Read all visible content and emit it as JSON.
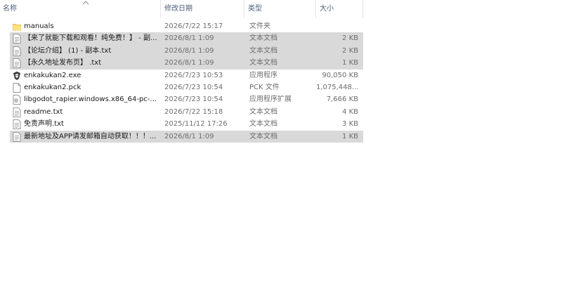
{
  "columns": {
    "name": "名称",
    "date": "修改日期",
    "type": "类型",
    "size": "大小"
  },
  "files": [
    {
      "name": "manuals",
      "date": "2026/7/22 15:17",
      "type": "文件夹",
      "size": "",
      "icon": "folder-icon",
      "selected": false
    },
    {
      "name": "【来了就能下载和观看！纯免费！】 - 副...",
      "date": "2026/8/1 1:09",
      "type": "文本文档",
      "size": "2 KB",
      "icon": "text-file-icon",
      "selected": true
    },
    {
      "name": "【论坛介绍】 (1) - 副本.txt",
      "date": "2026/8/1 1:09",
      "type": "文本文档",
      "size": "2 KB",
      "icon": "text-file-icon",
      "selected": true
    },
    {
      "name": "【永久地址发布页】 .txt",
      "date": "2026/8/1 1:09",
      "type": "文本文档",
      "size": "1 KB",
      "icon": "text-file-icon",
      "selected": true
    },
    {
      "name": "enkakukan2.exe",
      "date": "2026/7/23 10:53",
      "type": "应用程序",
      "size": "90,050 KB",
      "icon": "app-exe-icon",
      "selected": false
    },
    {
      "name": "enkakukan2.pck",
      "date": "2026/7/23 10:54",
      "type": "PCK 文件",
      "size": "1,075,448...",
      "icon": "blank-file-icon",
      "selected": false
    },
    {
      "name": "libgodot_rapier.windows.x86_64-pc-...",
      "date": "2026/7/23 10:54",
      "type": "应用程序扩展",
      "size": "7,666 KB",
      "icon": "dll-file-icon",
      "selected": false
    },
    {
      "name": "readme.txt",
      "date": "2026/7/22 15:18",
      "type": "文本文档",
      "size": "4 KB",
      "icon": "text-file-icon",
      "selected": false
    },
    {
      "name": "免责声明.txt",
      "date": "2025/11/12 17:26",
      "type": "文本文档",
      "size": "3 KB",
      "icon": "text-file-icon",
      "selected": false
    },
    {
      "name": "最新地址及APP请发邮箱自动获取！！！...",
      "date": "2026/8/1 1:09",
      "type": "文本文档",
      "size": "1 KB",
      "icon": "text-file-icon",
      "selected": true
    }
  ]
}
